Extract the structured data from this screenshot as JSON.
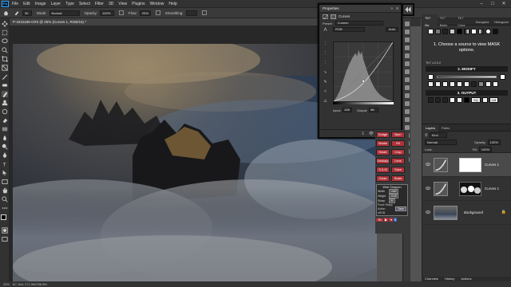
{
  "menubar": {
    "logo": "Ps",
    "items": [
      "File",
      "Edit",
      "Image",
      "Layer",
      "Type",
      "Select",
      "Filter",
      "3D",
      "View",
      "Plugins",
      "Window",
      "Help"
    ]
  },
  "options": {
    "mode_label": "Mode:",
    "mode_value": "Normal",
    "opacity_label": "Opacity:",
    "opacity_value": "100%",
    "flow_label": "Flow:",
    "flow_value": "20%",
    "smoothing_label": "Smoothing:",
    "smoothing_value": ""
  },
  "document": {
    "tab_title": "P-3431196-CR3 @ 25% (Curves 1, RGB/16) *"
  },
  "status": {
    "zoom": "25%",
    "doc_info": "6C 3bit: 171.9M/258.9M"
  },
  "properties": {
    "title": "Properties",
    "sub_title": "Curves",
    "preset_label": "Preset:",
    "preset_value": "Custom",
    "channel_value": "RGB",
    "auto_label": "Auto",
    "input_label": "Input:",
    "input_value": "128",
    "output_label": "Output:",
    "output_value": "96"
  },
  "tk7": {
    "tabs": [
      "TK7 Go",
      "TK7 Basic",
      "TK7 Color",
      "Navigator",
      "Histogram"
    ],
    "message": "1. Choose a source to view MASK options.",
    "version": "TK7 v.2.0.2",
    "modify_label": "2. MODIFY",
    "output_label": "3. OUTPUT",
    "sq_label": "SQ",
    "lm_label": "LM"
  },
  "actions": {
    "buttons": [
      {
        "label": "Dodge",
        "color": "#b0323a"
      },
      {
        "label": "Burn",
        "color": "#b0323a"
      },
      {
        "label": "Stroke",
        "color": "#b0323a"
      },
      {
        "label": "Fill",
        "color": "#b0323a"
      },
      {
        "label": "Smart",
        "color": "#b0323a"
      },
      {
        "label": "Crop",
        "color": "#b0323a"
      },
      {
        "label": "Unsharp",
        "color": "#b0323a"
      },
      {
        "label": "Lens",
        "color": "#b0323a"
      },
      {
        "label": "S & M",
        "color": "#b0323a"
      },
      {
        "label": "Save",
        "color": "#b0323a"
      },
      {
        "label": "Clean",
        "color": "#b0323a"
      },
      {
        "label": "Scale",
        "color": "#b0323a"
      }
    ],
    "web_sharpen": "Web Sharpen",
    "w_label": "Width",
    "w_value": "1080",
    "h_label": "Height",
    "h_value": "2048",
    "s_label": "Sharp",
    "s_value": "50",
    "opts": [
      "Force Sharp",
      "Action",
      "sRGB"
    ],
    "save": "Save",
    "tk": "TK"
  },
  "layers": {
    "tabs": [
      "Layers",
      "Paths"
    ],
    "search_label": "Kind",
    "blend_value": "Normal",
    "opacity_label": "Opacity:",
    "opacity_value": "100%",
    "lock_label": "Lock:",
    "fill_label": "Fill:",
    "fill_value": "100%",
    "items": [
      {
        "name": "Curves 1",
        "selected": true
      },
      {
        "name": "Curves 1",
        "selected": false
      },
      {
        "name": "Background",
        "selected": false
      }
    ],
    "bottom_tabs": [
      "Channels",
      "History",
      "Actions"
    ]
  },
  "colors": {
    "accent": "#31a8ff",
    "panel_bg": "#323232",
    "action_red": "#b0323a"
  }
}
